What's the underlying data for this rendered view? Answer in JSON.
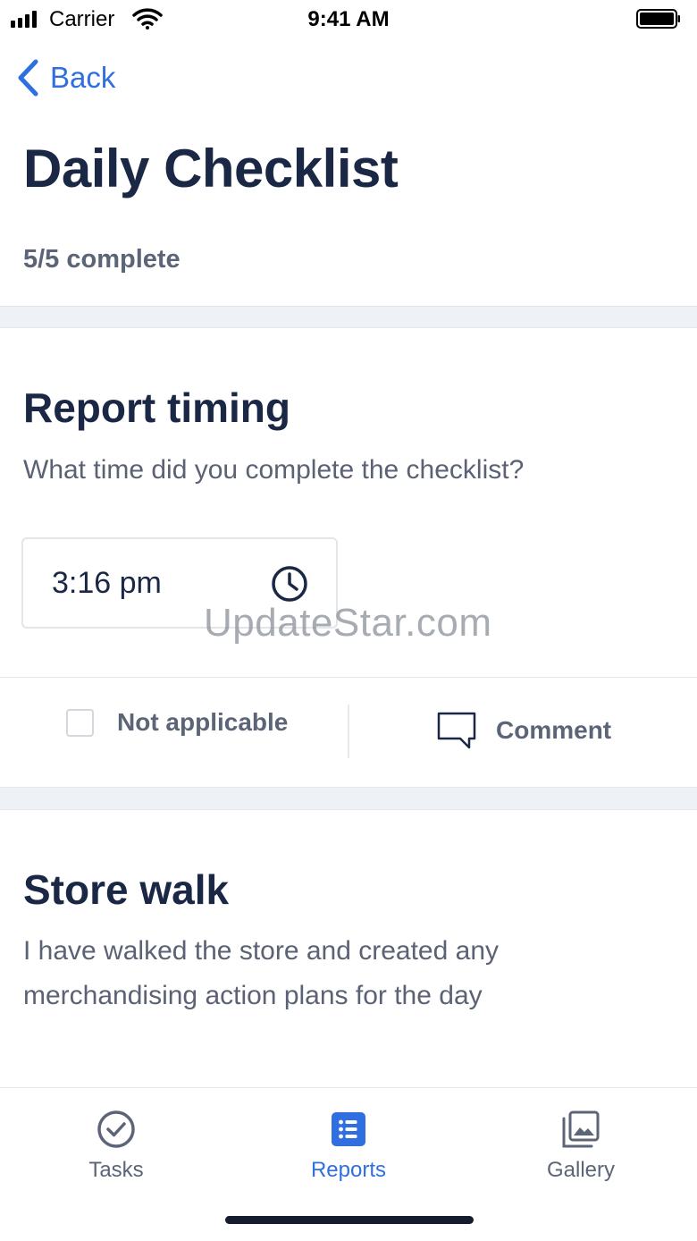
{
  "status_bar": {
    "carrier": "Carrier",
    "time": "9:41 AM"
  },
  "nav": {
    "back_label": "Back"
  },
  "page": {
    "title": "Daily Checklist",
    "progress": "5/5 complete"
  },
  "items": [
    {
      "title": "Report timing",
      "description": "What time did you complete the checklist?",
      "time_value": "3:16 pm",
      "not_applicable_label": "Not applicable",
      "comment_label": "Comment"
    },
    {
      "title": "Store walk",
      "description": "I have walked the store and created any merchandising action plans for the day"
    }
  ],
  "watermark": "UpdateStar.com",
  "tabbar": {
    "tabs": [
      {
        "label": "Tasks",
        "icon": "check-circle-icon"
      },
      {
        "label": "Reports",
        "icon": "list-icon",
        "active": true
      },
      {
        "label": "Gallery",
        "icon": "gallery-icon"
      }
    ]
  },
  "colors": {
    "accent": "#2f6fe0",
    "title": "#1a2745",
    "muted": "#5c6477"
  }
}
